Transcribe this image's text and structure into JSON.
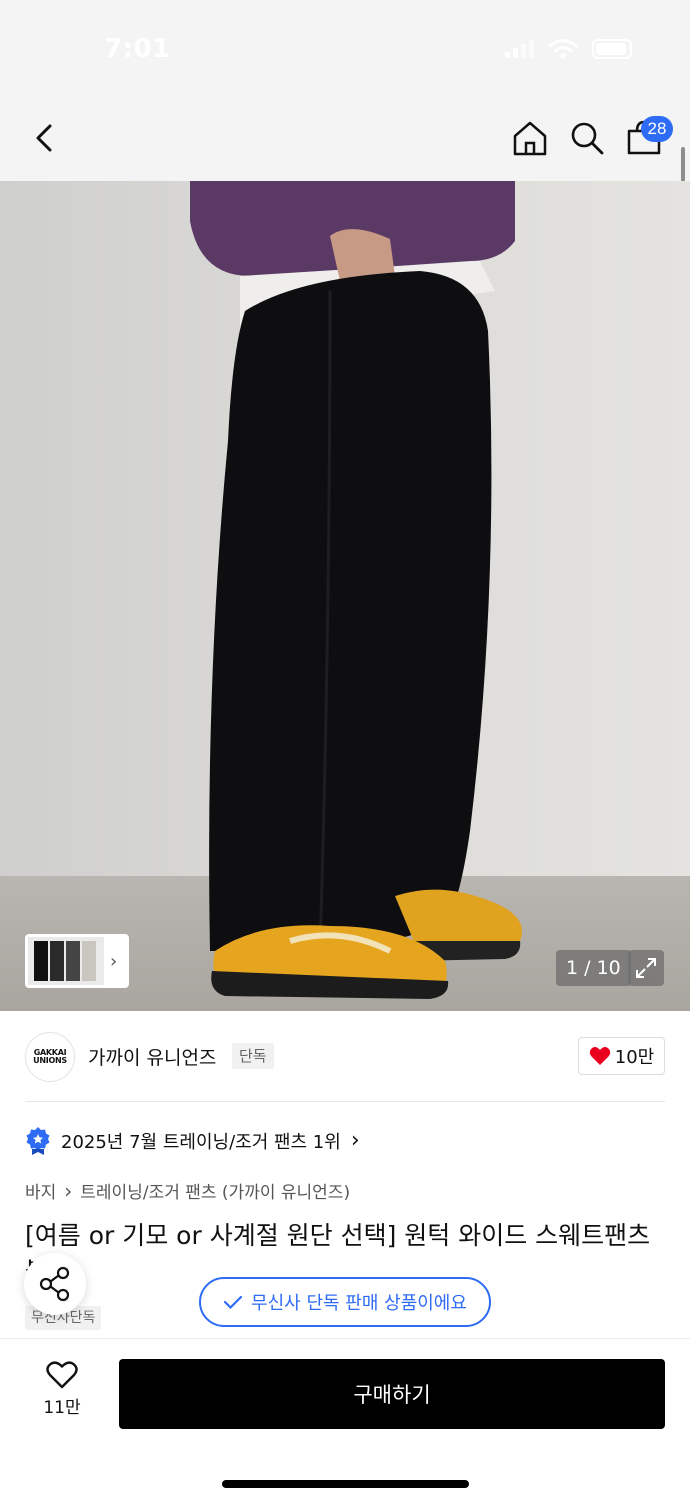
{
  "status_bar": {
    "time": "7:01"
  },
  "header": {
    "cart_count": "28"
  },
  "gallery": {
    "counter": "1 / 10"
  },
  "brand": {
    "logo_line1": "GAKKAI",
    "logo_line2": "UNIONS",
    "name": "가까이 유니언즈",
    "tag": "단독",
    "likes": "10만"
  },
  "ranking": {
    "text": "2025년 7월 트레이닝/조거 팬츠 1위"
  },
  "breadcrumb": {
    "level1": "바지",
    "level2": "트레이닝/조거 팬츠 (가까이 유니언즈)"
  },
  "product": {
    "title": "[여름 or 기모 or 사계절 원단 선택] 원턱 와이드 스웨트팬츠 블랙",
    "exclusive_tag": "무신사단독"
  },
  "toast": {
    "text": "무신사 단독 판매 상품이에요"
  },
  "bottom_bar": {
    "favorite_count": "11만",
    "buy_label": "구매하기"
  },
  "colors": {
    "accent_blue": "#2f6cf6",
    "heart_red": "#e8001c",
    "buy_black": "#000000"
  }
}
